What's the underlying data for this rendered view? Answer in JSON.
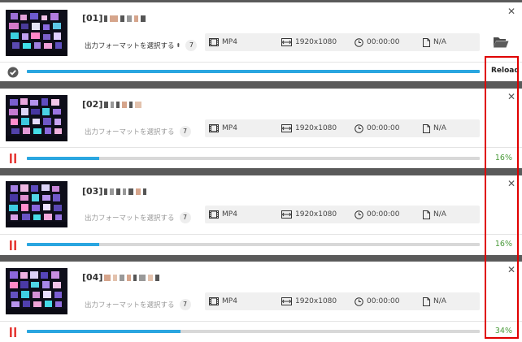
{
  "items": [
    {
      "title": "[01]",
      "format_label": "出力フォーマットを選択する",
      "format_count": "7",
      "container": "MP4",
      "resolution": "1920x1080",
      "duration": "00:00:00",
      "size": "N/A",
      "status": "completed",
      "progress": 1.0,
      "action_label": "Reload"
    },
    {
      "title": "[02]",
      "format_label": "出力フォーマットを選択する",
      "format_count": "7",
      "container": "MP4",
      "resolution": "1920x1080",
      "duration": "00:00:00",
      "size": "N/A",
      "status": "paused",
      "progress": 0.16,
      "percent_label": "16%"
    },
    {
      "title": "[03]",
      "format_label": "出力フォーマットを選択する",
      "format_count": "7",
      "container": "MP4",
      "resolution": "1920x1080",
      "duration": "00:00:00",
      "size": "N/A",
      "status": "paused",
      "progress": 0.16,
      "percent_label": "16%"
    },
    {
      "title": "[04]",
      "format_label": "出力フォーマットを選択する",
      "format_count": "7",
      "container": "MP4",
      "resolution": "1920x1080",
      "duration": "00:00:00",
      "size": "N/A",
      "status": "paused",
      "progress": 0.34,
      "percent_label": "34%"
    }
  ],
  "icons": {
    "close": "close-icon",
    "folder": "folder-open-icon",
    "film": "film-icon",
    "resolution": "resolution-icon",
    "clock": "clock-icon",
    "file": "file-icon",
    "check": "check-circle-icon",
    "pause": "pause-icon"
  },
  "colors": {
    "progress_fill": "#2aa6e0",
    "progress_track": "#d8d8d8",
    "percent_text": "#4a9a3a",
    "pause_icon": "#e53935",
    "highlight": "#e00000"
  }
}
